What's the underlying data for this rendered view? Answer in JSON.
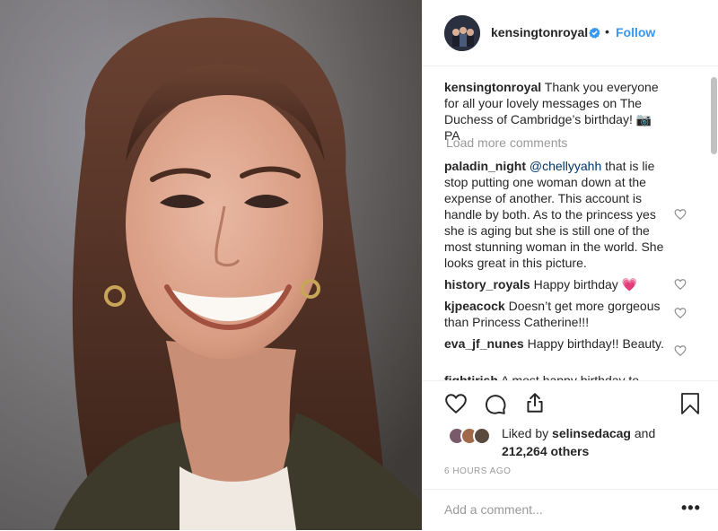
{
  "header": {
    "username": "kensingtonroyal",
    "dot": "•",
    "follow_label": "Follow"
  },
  "caption": {
    "username": "kensingtonroyal",
    "text": " Thank you everyone for all your lovely messages on The Duchess of Cambridge’s birthday! 📷PA"
  },
  "load_more_label": "Load more comments",
  "comments": [
    {
      "username": "paladin_night",
      "mention": "@chellyyahh",
      "text": " that is lie stop putting one woman down at the expense of another. This account is handle by both. As to the princess yes she is aging but she is still one of the most stunning woman in the world. She looks great in this picture."
    },
    {
      "username": "history_royals",
      "text": " Happy birthday 💗"
    },
    {
      "username": "kjpeacock",
      "text": " Doesn’t get more gorgeous than Princess Catherine!!!"
    },
    {
      "username": "eva_jf_nunes",
      "text": " Happy birthday!! Beauty."
    },
    {
      "username": "fightirish",
      "text": " A most happy birthday to"
    }
  ],
  "likes": {
    "prefix": "Liked by ",
    "user": "selinsedacag",
    "middle": " and ",
    "count": "212,264 others"
  },
  "timestamp": "6 HOURS AGO",
  "add_comment": {
    "placeholder": "Add a comment..."
  },
  "more_label": "•••",
  "colors": {
    "link": "#3897f0",
    "verified": "#3897f0",
    "muted": "#999999",
    "text": "#262626",
    "mention": "#003569"
  },
  "icons": [
    "verified-badge-icon",
    "heart-icon",
    "comment-icon",
    "share-icon",
    "bookmark-icon",
    "more-options-icon"
  ]
}
